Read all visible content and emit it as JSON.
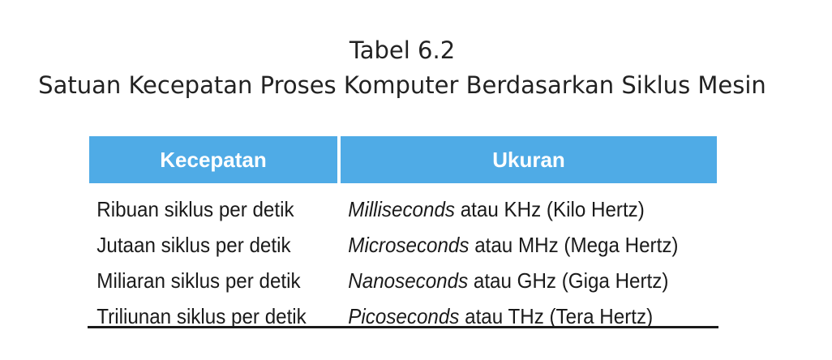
{
  "caption": {
    "number": "Tabel 6.2",
    "title": "Satuan Kecepatan Proses Komputer Berdasarkan Siklus Mesin"
  },
  "table": {
    "headers": [
      "Kecepatan",
      "Ukuran"
    ],
    "rows": [
      {
        "speed": "Ribuan siklus per detik",
        "term": "Milliseconds",
        "rest": " atau KHz (Kilo Hertz)"
      },
      {
        "speed": "Jutaan siklus per detik",
        "term": "Microseconds",
        "rest": " atau MHz (Mega Hertz)"
      },
      {
        "speed": "Miliaran siklus per detik",
        "term": "Nanoseconds",
        "rest": " atau GHz (Giga Hertz)"
      },
      {
        "speed": "Triliunan siklus per detik",
        "term": "Picoseconds",
        "rest": " atau THz (Tera Hertz)"
      }
    ]
  },
  "colors": {
    "header_background": "#4fabe6",
    "header_text": "#ffffff"
  }
}
